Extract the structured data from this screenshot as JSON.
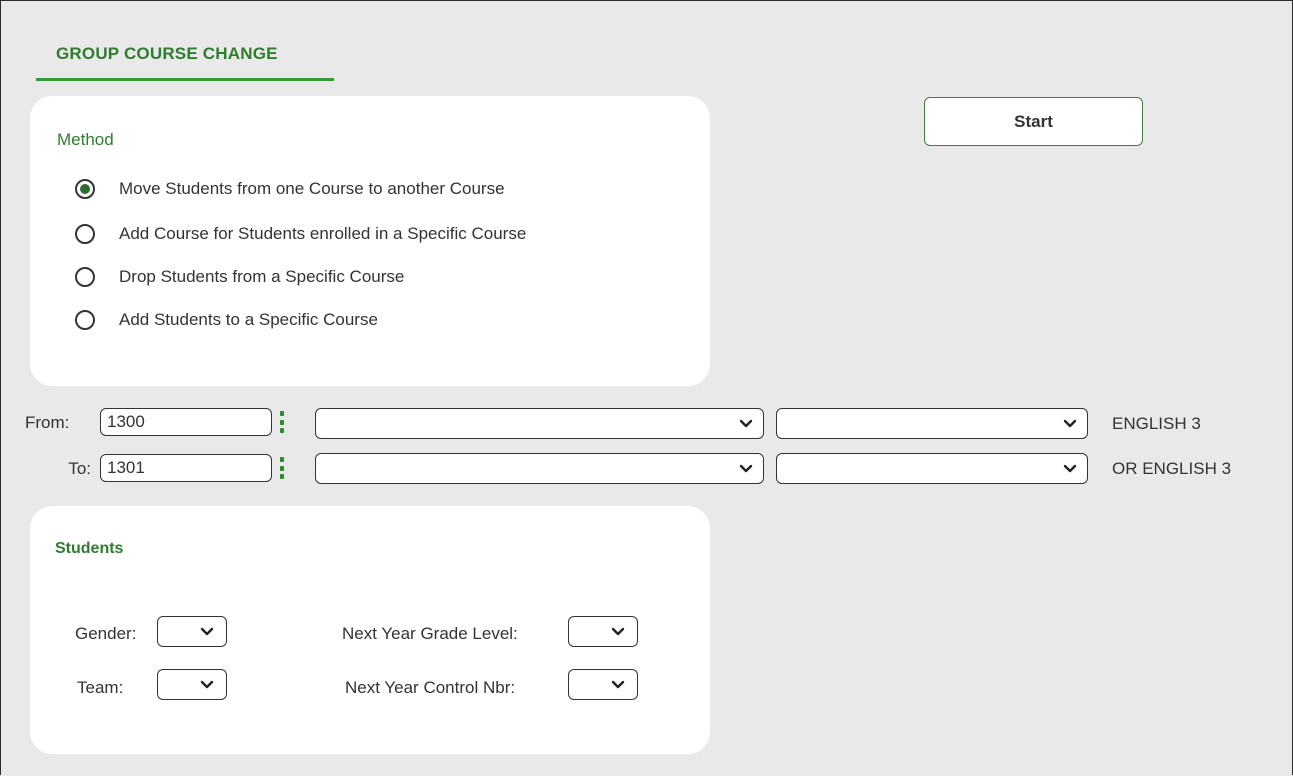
{
  "tab": {
    "label": "GROUP COURSE CHANGE"
  },
  "method": {
    "title": "Method",
    "options": [
      {
        "label": "Move Students from one Course to another Course",
        "checked": true
      },
      {
        "label": "Add Course for Students enrolled in a Specific Course",
        "checked": false
      },
      {
        "label": "Drop Students from a Specific Course",
        "checked": false
      },
      {
        "label": "Add Students to a Specific Course",
        "checked": false
      }
    ]
  },
  "start_button": {
    "label": "Start"
  },
  "from": {
    "label": "From:",
    "value": "1300",
    "course_name": "ENGLISH 3",
    "select1": "",
    "select2": ""
  },
  "to": {
    "label": "To:",
    "value": "1301",
    "course_name": "OR ENGLISH 3",
    "select1": "",
    "select2": ""
  },
  "students": {
    "title": "Students",
    "gender_label": "Gender:",
    "team_label": "Team:",
    "next_year_grade_label": "Next Year Grade Level:",
    "next_year_control_label": "Next Year Control Nbr:"
  },
  "colors": {
    "accent": "#2f7d2f",
    "underline": "#3a9a3a",
    "panel_bg": "#ffffff",
    "page_bg": "#e9e9e9"
  },
  "icons": {
    "lookup": "vertical-ellipsis-icon",
    "dropdown": "chevron-down-icon",
    "radio": "radio-icon"
  }
}
